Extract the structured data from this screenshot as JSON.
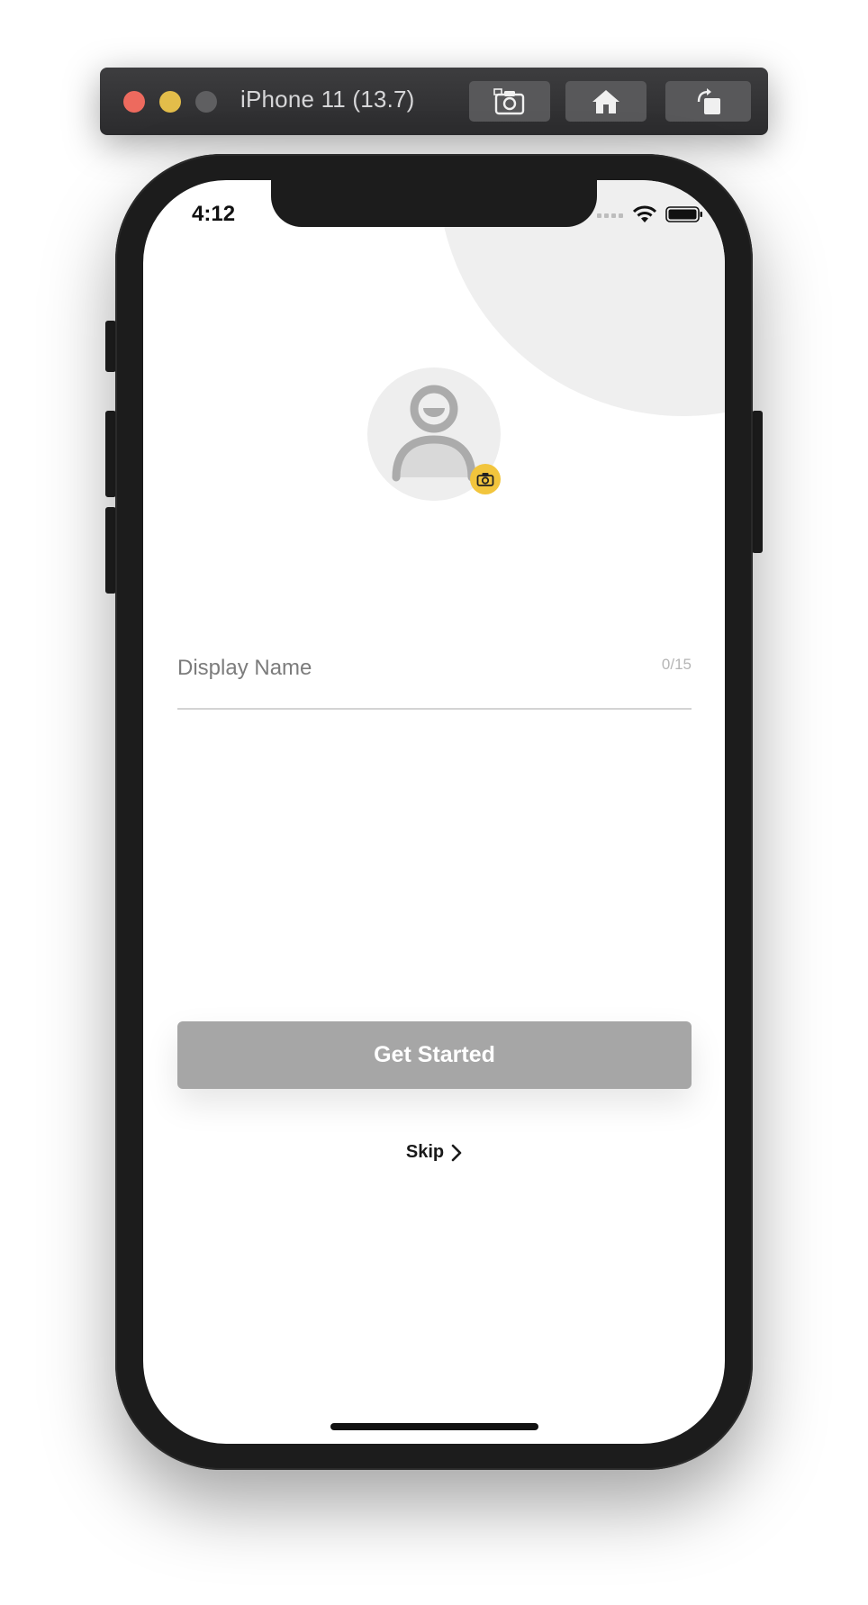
{
  "simulator": {
    "title": "iPhone 11 (13.7)",
    "buttons": [
      "screenshot-icon",
      "home-icon",
      "rotate-icon"
    ]
  },
  "status_bar": {
    "time": "4:12"
  },
  "profile": {
    "avatar_icon": "user-avatar-icon",
    "badge_icon": "camera-icon",
    "badge_color": "#f2c53d"
  },
  "form": {
    "display_name_placeholder": "Display Name",
    "display_name_value": "",
    "counter": "0/15"
  },
  "actions": {
    "get_started_label": "Get Started",
    "skip_label": "Skip"
  },
  "colors": {
    "button_disabled": "#a6a6a6",
    "background_circle": "#efefef"
  }
}
